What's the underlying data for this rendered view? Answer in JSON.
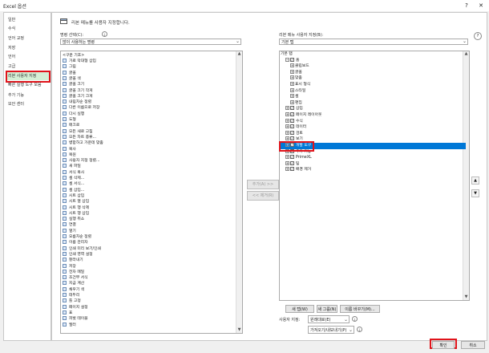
{
  "window": {
    "title": "Excel 옵션",
    "help_label": "?",
    "close_label": "✕"
  },
  "sidebar": {
    "items": [
      {
        "label": "일반"
      },
      {
        "label": "수식"
      },
      {
        "label": "언어 교정"
      },
      {
        "label": "저장"
      },
      {
        "label": "언어"
      },
      {
        "label": "고급"
      },
      {
        "label": "리본 사용자 지정"
      },
      {
        "label": "빠른 실행 도구 모음"
      },
      {
        "label": "추가 기능"
      },
      {
        "label": "보안 센터"
      }
    ],
    "selected": "리본 사용자 지정"
  },
  "header": {
    "description": "리본 메뉴를 사용자 지정합니다."
  },
  "left": {
    "label": "명령 선택(C):",
    "dropdown_value": "많이 사용하는 명령",
    "list_header": "<구분 기호>",
    "commands": [
      "가로 막대형 삽입",
      "그림",
      "글꼴",
      "글꼴 색",
      "글꼴 크기",
      "글꼴 크기 작게",
      "글꼴 크기 크게",
      "내림차순 정렬",
      "다른 이름으로 저장",
      "다시 실행",
      "도형",
      "매크로",
      "모든 새로 고침",
      "모든 차트 종류...",
      "병합하고 가운데 맞춤",
      "복사",
      "복원",
      "사용자 지정 정렬...",
      "새 파일",
      "서식 복사",
      "셀 삭제...",
      "셀 서식...",
      "셀 삽입...",
      "시트 삽입",
      "시트 열 삽입",
      "시트 행 삭제",
      "시트 행 삽입",
      "실행 취소",
      "연결",
      "열기",
      "오름차순 정렬",
      "이름 관리자",
      "인쇄 미리 보기/인쇄",
      "인쇄 영역 설정",
      "잘라내기",
      "저장",
      "전자 메일",
      "조건부 서식",
      "지금 계산",
      "채우기 색",
      "테두리",
      "틀 고정",
      "페이지 설정",
      "표",
      "피벗 테이블",
      "필터"
    ]
  },
  "middle": {
    "add_button": "추가(A) >>",
    "remove_button": "<< 제거(R)"
  },
  "right": {
    "label": "리본 메뉴 사용자 지정(B):",
    "dropdown_value": "기본 탭",
    "tree": [
      {
        "label": "기본 탭",
        "level": 0
      },
      {
        "label": "홈",
        "level": 1,
        "toggle": "⊟",
        "checked": true
      },
      {
        "label": "클립보드",
        "level": 2,
        "toggle": "⊞"
      },
      {
        "label": "글꼴",
        "level": 2,
        "toggle": "⊞"
      },
      {
        "label": "맞춤",
        "level": 2,
        "toggle": "⊞"
      },
      {
        "label": "표시 형식",
        "level": 2,
        "toggle": "⊞"
      },
      {
        "label": "스타일",
        "level": 2,
        "toggle": "⊞"
      },
      {
        "label": "셀",
        "level": 2,
        "toggle": "⊞"
      },
      {
        "label": "편집",
        "level": 2,
        "toggle": "⊞"
      },
      {
        "label": "삽입",
        "level": 1,
        "toggle": "⊞",
        "checked": true
      },
      {
        "label": "페이지 레이아웃",
        "level": 1,
        "toggle": "⊞",
        "checked": true
      },
      {
        "label": "수식",
        "level": 1,
        "toggle": "⊞",
        "checked": true
      },
      {
        "label": "데이터",
        "level": 1,
        "toggle": "⊞",
        "checked": true
      },
      {
        "label": "검토",
        "level": 1,
        "toggle": "⊞",
        "checked": true
      },
      {
        "label": "보기",
        "level": 1,
        "toggle": "⊞",
        "checked": true
      },
      {
        "label": "개발 도구",
        "level": 1,
        "toggle": "⊞",
        "checked": true,
        "selected": true
      },
      {
        "label": "추가 기능",
        "level": 1,
        "toggle": "⊞",
        "checked": true
      },
      {
        "label": "PrimeXL",
        "level": 1,
        "toggle": "⊞",
        "checked": true
      },
      {
        "label": "팀",
        "level": 1,
        "toggle": "⊞",
        "checked": true
      },
      {
        "label": "배경 제거",
        "level": 1,
        "toggle": "⊞",
        "checked": true
      }
    ],
    "new_tab": "새 탭(W)",
    "new_group": "새 그룹(N)",
    "rename": "이름 바꾸기(M)...",
    "customize_label": "사용자 지정:",
    "reset_value": "원래대로(E)",
    "import_export": "가져오기/내보내기(P)"
  },
  "footer": {
    "ok": "확인",
    "cancel": "취소"
  },
  "colors": {
    "selection": "#0078d7",
    "highlight_box": "#e0141b",
    "sidebar_selected": "#d5f0d5"
  }
}
